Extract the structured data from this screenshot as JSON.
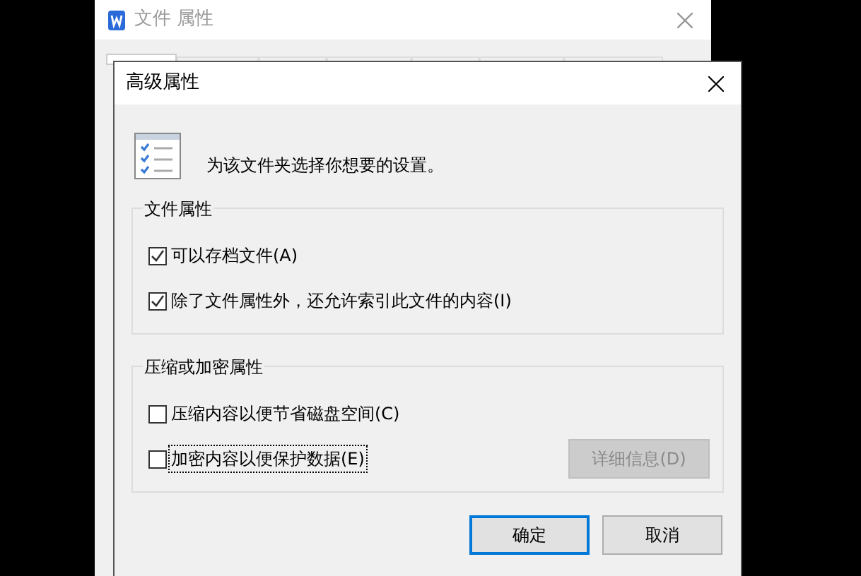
{
  "back_window": {
    "title": "文件 属性",
    "tabs": [
      {
        "selected": true
      },
      {
        "selected": false
      },
      {
        "selected": false
      },
      {
        "selected": false
      },
      {
        "selected": false
      },
      {
        "selected": false
      },
      {
        "selected": false
      }
    ]
  },
  "dialog": {
    "title": "高级属性",
    "intro": "为该文件夹选择你想要的设置。",
    "groups": [
      {
        "title": "文件属性",
        "options": [
          {
            "label": "可以存档文件(A)",
            "checked": true,
            "focused": false
          },
          {
            "label": "除了文件属性外，还允许索引此文件的内容(I)",
            "checked": true,
            "focused": false
          }
        ]
      },
      {
        "title": "压缩或加密属性",
        "options": [
          {
            "label": "压缩内容以便节省磁盘空间(C)",
            "checked": false,
            "focused": false
          },
          {
            "label": "加密内容以便保护数据(E)",
            "checked": false,
            "focused": true
          }
        ],
        "button": {
          "label": "详细信息(D)",
          "disabled": true
        }
      }
    ],
    "buttons": [
      {
        "label": "确定",
        "default": true
      },
      {
        "label": "取消",
        "default": false
      }
    ]
  }
}
